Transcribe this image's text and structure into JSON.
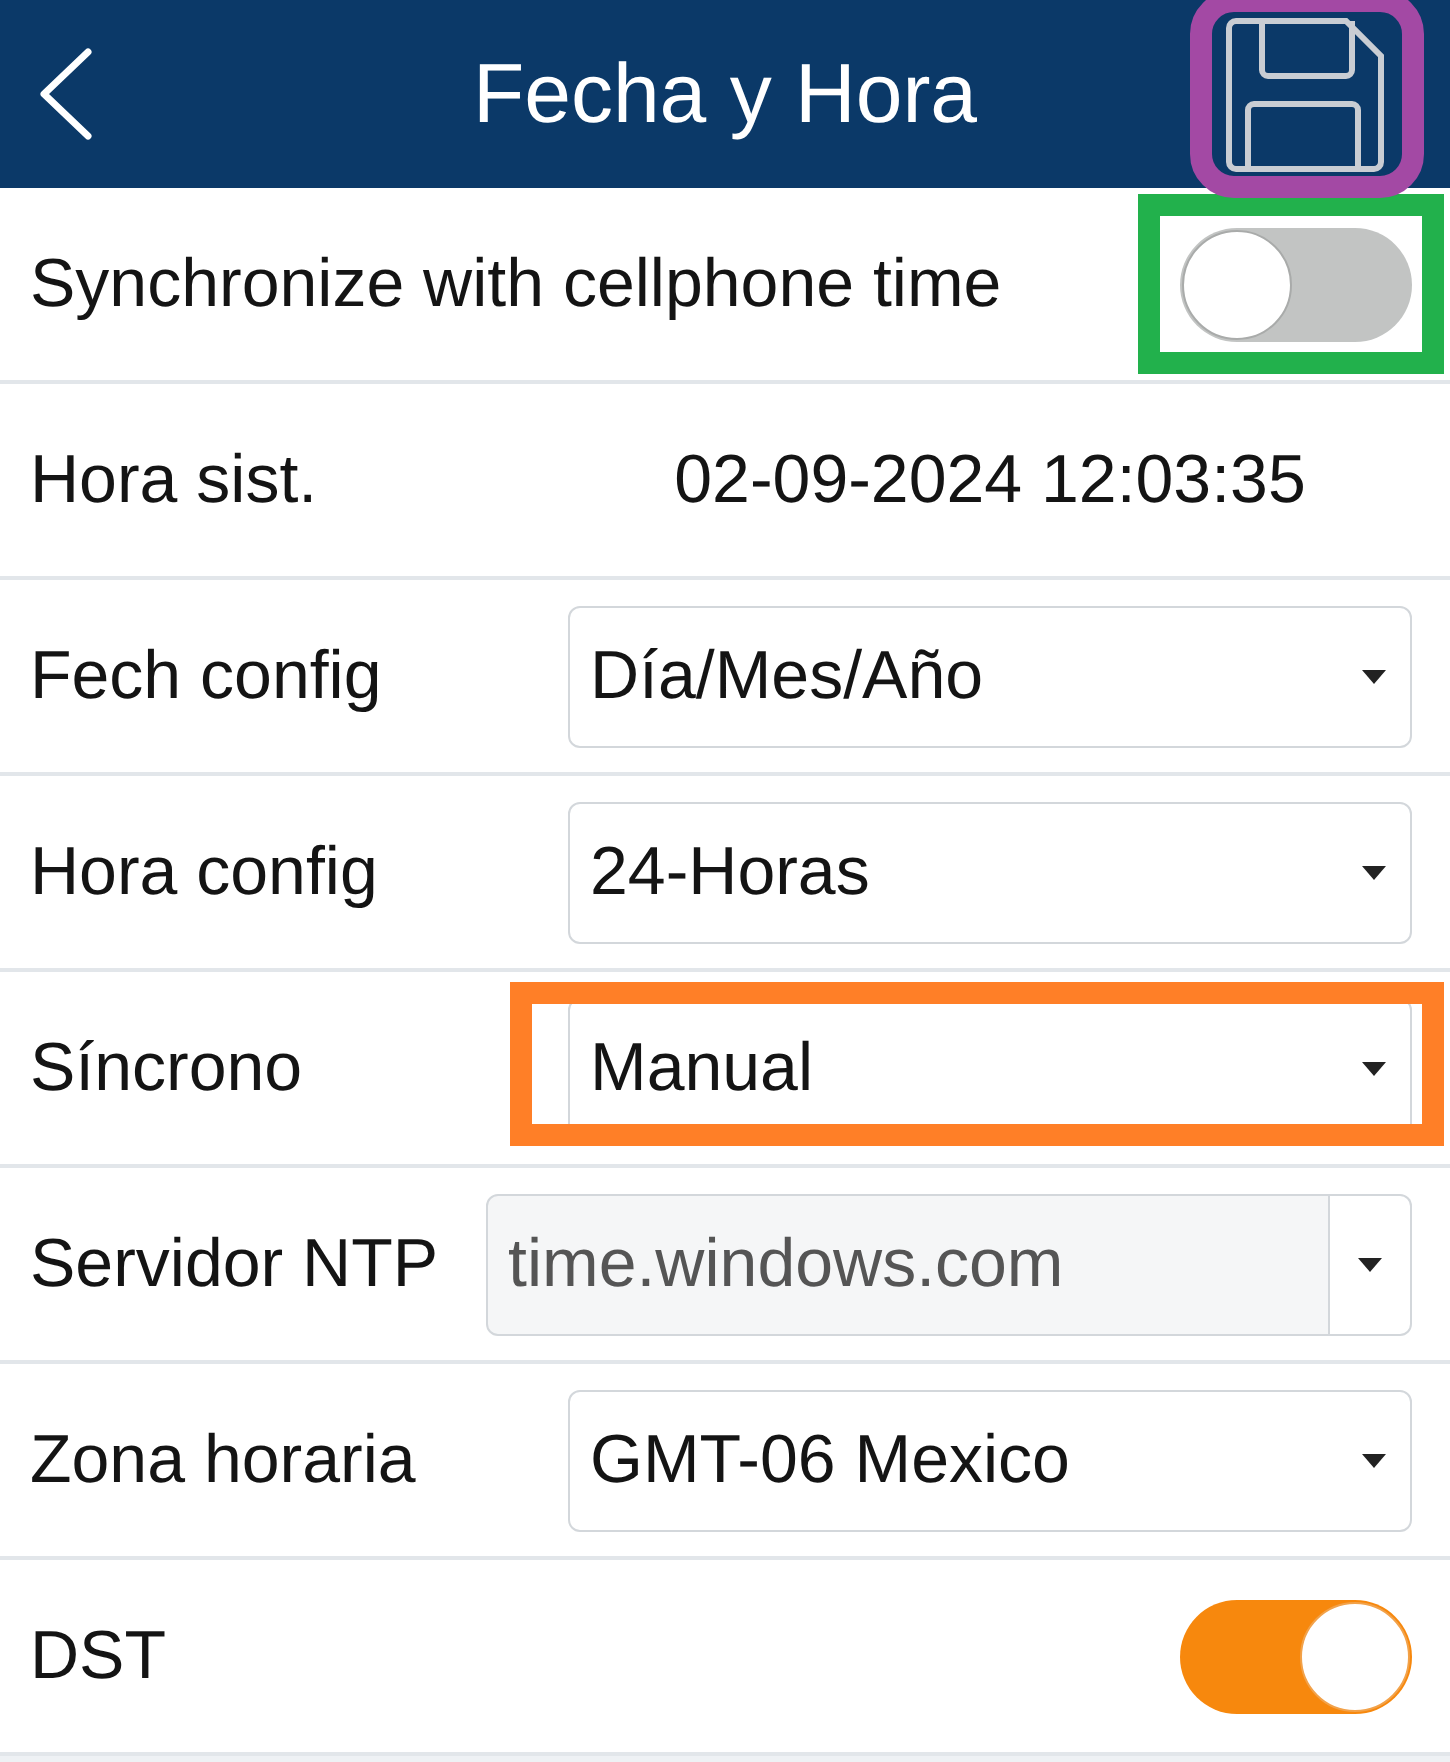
{
  "header": {
    "title": "Fecha y Hora",
    "save_highlight": {
      "color": "#a349a4"
    }
  },
  "rows": [
    {
      "kind": "toggle",
      "label": "Synchronize with cellphone time",
      "on": false,
      "highlight": {
        "color": "#22b14c"
      }
    },
    {
      "kind": "text",
      "label": "Hora sist.",
      "value": "02-09-2024 12:03:35"
    },
    {
      "kind": "select",
      "label": "Fech config",
      "value": "Día/Mes/Año"
    },
    {
      "kind": "select",
      "label": "Hora config",
      "value": "24-Horas"
    },
    {
      "kind": "select",
      "label": "Síncrono",
      "value": "Manual",
      "highlight": {
        "color": "#ff7f27"
      }
    },
    {
      "kind": "combo",
      "label": "Servidor NTP",
      "value": "time.windows.com",
      "disabled": true
    },
    {
      "kind": "select",
      "label": "Zona horaria",
      "value": "GMT-06 Mexico"
    },
    {
      "kind": "toggle",
      "label": "DST",
      "on": true
    }
  ]
}
